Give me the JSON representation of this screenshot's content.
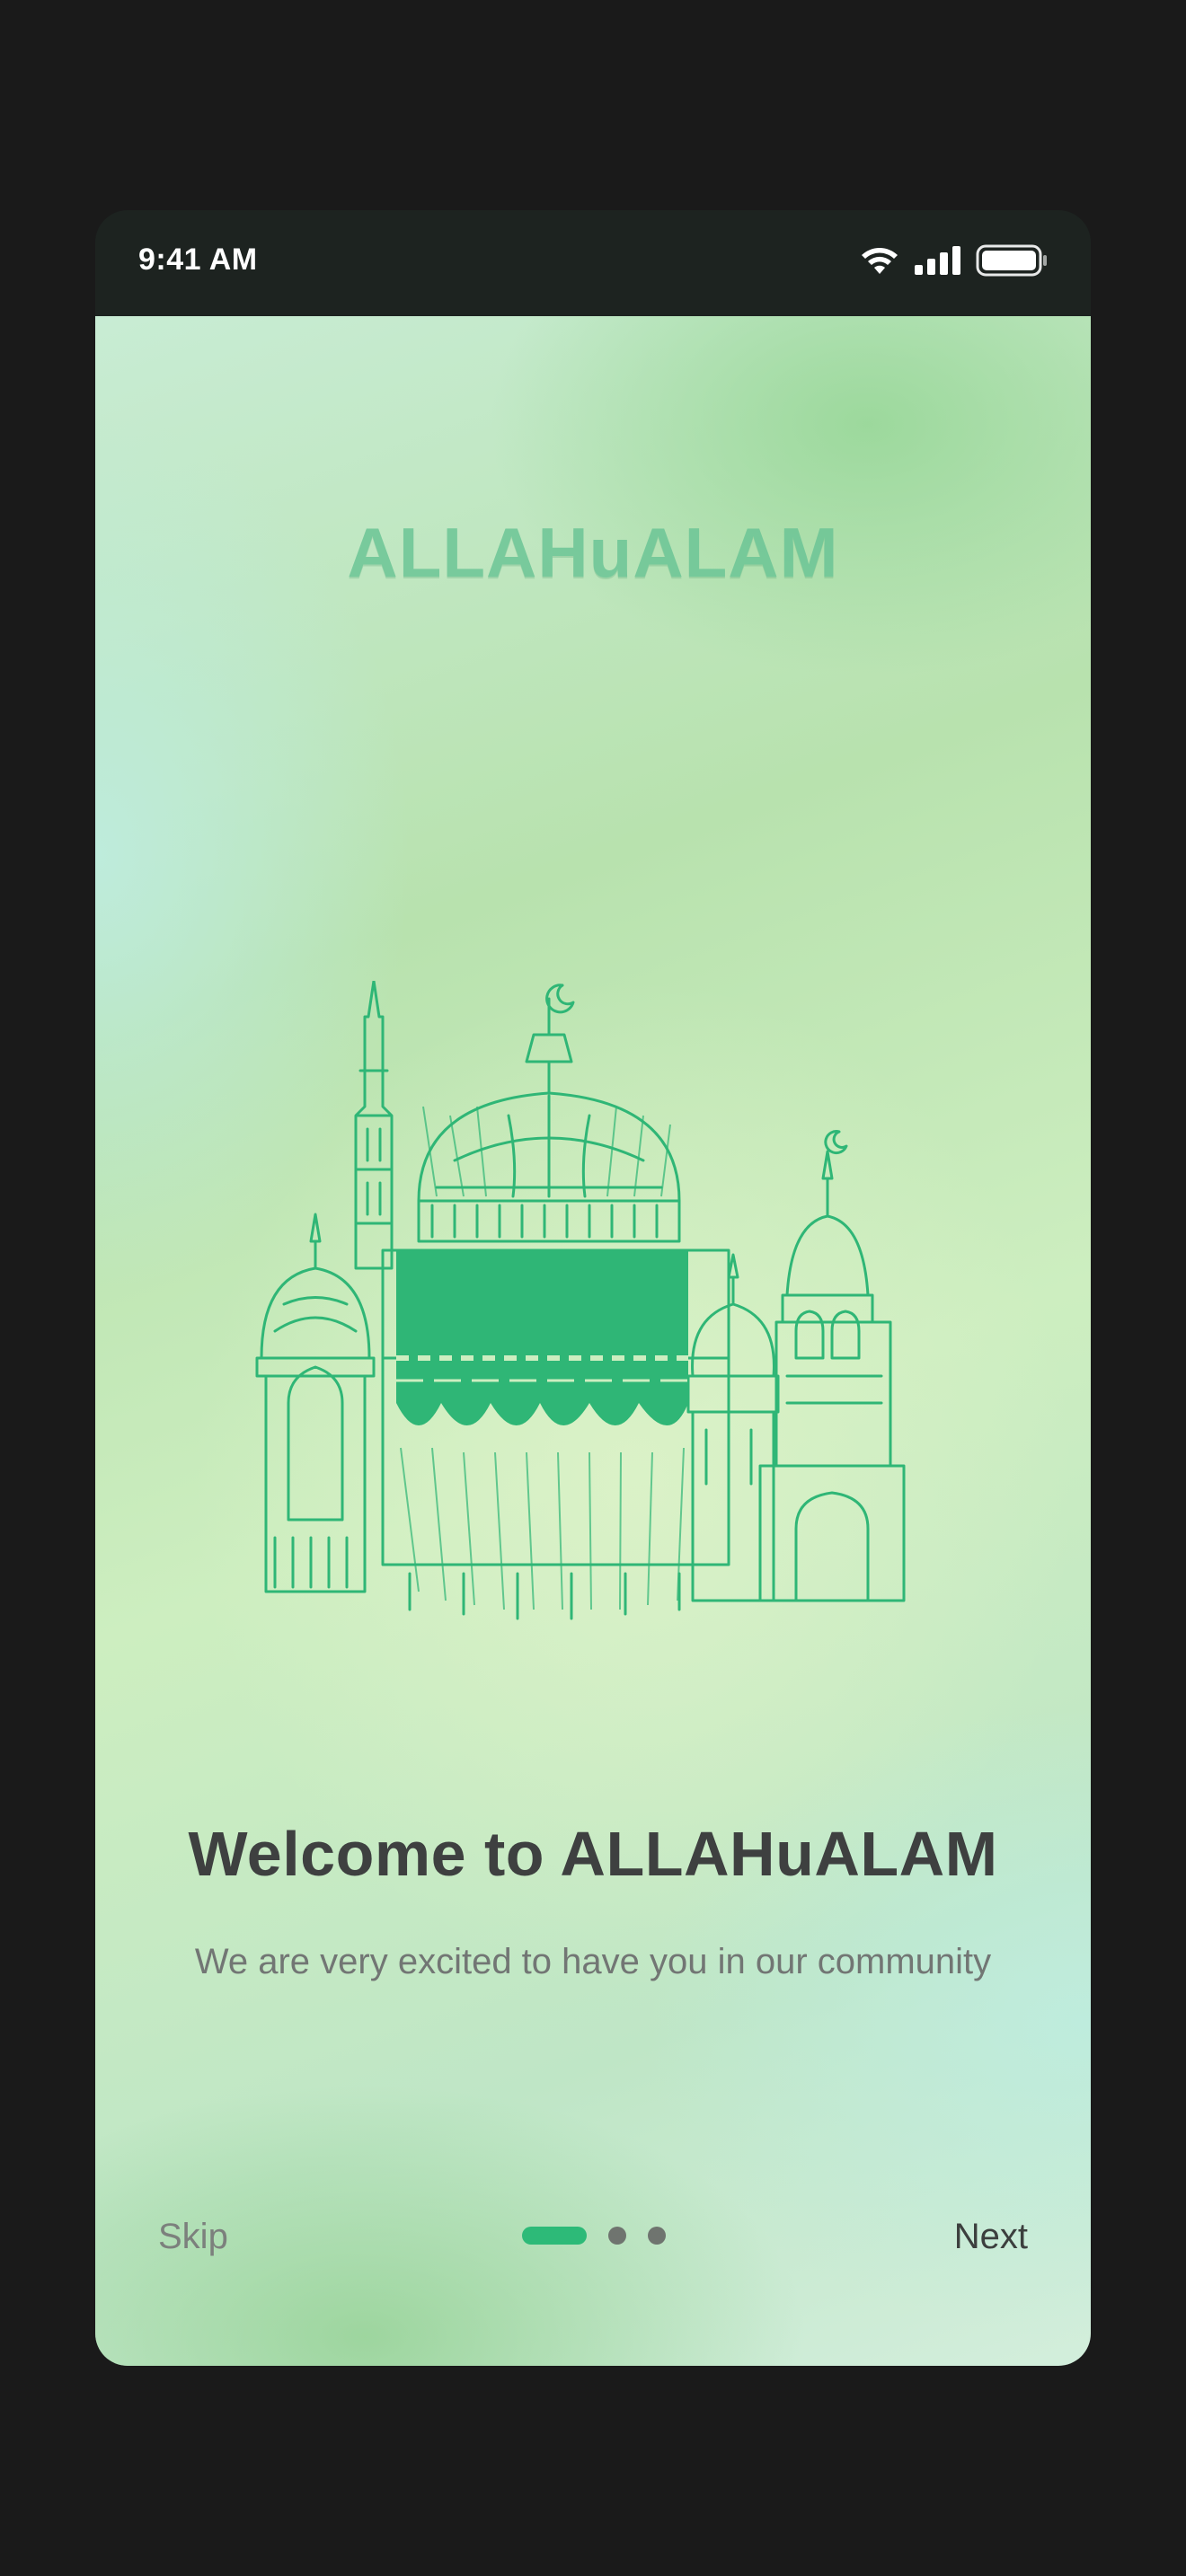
{
  "status_bar": {
    "time": "9:41 AM",
    "icons": [
      "wifi-icon",
      "cellular-signal-icon",
      "battery-icon"
    ]
  },
  "brand": {
    "logo_text": "ALLAHuALAM",
    "accent_color": "#2dba78"
  },
  "illustration": {
    "icon": "mosque-kaaba-illustration"
  },
  "welcome": {
    "title": "Welcome to ALLAHuALAM",
    "subtitle": "We are very excited to have you in our community"
  },
  "navigation": {
    "skip_label": "Skip",
    "next_label": "Next",
    "page_count": 3,
    "current_page": 1
  }
}
